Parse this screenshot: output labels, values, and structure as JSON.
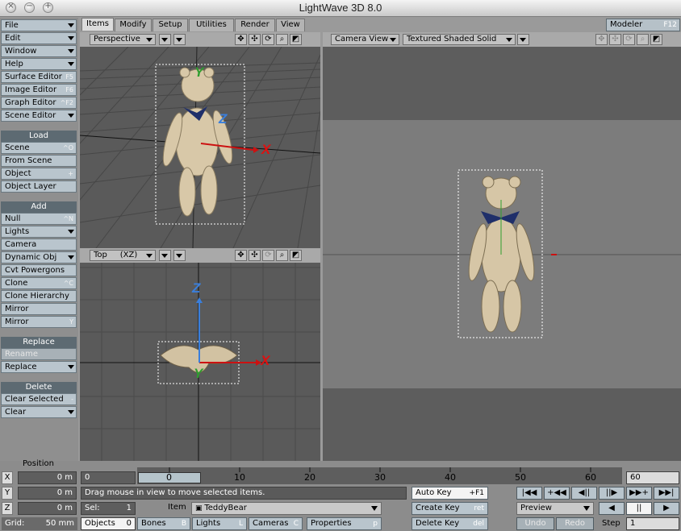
{
  "window": {
    "title": "LightWave 3D 8.0",
    "close_icon": "×",
    "min_icon": "−",
    "zoom_icon": "+"
  },
  "menus": [
    {
      "label": "File",
      "type": "dropdown"
    },
    {
      "label": "Edit",
      "type": "dropdown"
    },
    {
      "label": "Window",
      "type": "dropdown"
    },
    {
      "label": "Help",
      "type": "dropdown"
    },
    {
      "label": "Surface Editor",
      "shortcut": "F5"
    },
    {
      "label": "Image Editor",
      "shortcut": "F6"
    },
    {
      "label": "Graph Editor",
      "shortcut": "^F2"
    },
    {
      "label": "Scene Editor",
      "type": "dropdown"
    }
  ],
  "load": {
    "header": "Load",
    "items": [
      {
        "label": "Scene",
        "shortcut": "^O"
      },
      {
        "label": "From Scene",
        "shortcut": ""
      },
      {
        "label": "Object",
        "shortcut": "+"
      },
      {
        "label": "Object Layer",
        "shortcut": ""
      }
    ]
  },
  "add": {
    "header": "Add",
    "items": [
      {
        "label": "Null",
        "shortcut": "^N"
      },
      {
        "label": "Lights",
        "dropdown": true
      },
      {
        "label": "Camera",
        "shortcut": ""
      },
      {
        "label": "Dynamic Obj",
        "dropdown": true
      },
      {
        "label": "Cvt Powergons",
        "shortcut": ""
      },
      {
        "label": "Clone",
        "shortcut": "^C"
      },
      {
        "label": "Clone Hierarchy",
        "shortcut": ""
      },
      {
        "label": "Mirror",
        "shortcut": ""
      },
      {
        "label": "Mirror",
        "shortcut": "Y"
      }
    ]
  },
  "replace": {
    "header": "Replace",
    "items": [
      {
        "label": "Rename",
        "disabled": true
      },
      {
        "label": "Replace",
        "dropdown": true
      }
    ]
  },
  "delete": {
    "header": "Delete",
    "items": [
      {
        "label": "Clear Selected",
        "shortcut": "-"
      },
      {
        "label": "Clear",
        "dropdown": true
      }
    ]
  },
  "tabs": [
    "Items",
    "Modify",
    "Setup",
    "Utilities",
    "Render",
    "View"
  ],
  "active_tab": "Items",
  "modeler": {
    "label": "Modeler",
    "shortcut": "F12"
  },
  "viewports": {
    "perspective": {
      "view": "Perspective",
      "axes": {
        "x": "X",
        "y": "Y",
        "z": "Z"
      }
    },
    "top": {
      "view": "Top",
      "plane": "(XZ)",
      "axes": {
        "x": "X",
        "y": "Y",
        "z": "Z"
      }
    },
    "camera": {
      "view": "Camera View",
      "shading": "Textured Shaded Solid"
    }
  },
  "position": {
    "label": "Position",
    "x_label": "X",
    "y_label": "Y",
    "z_label": "Z",
    "x": "0 m",
    "y": "0 m",
    "z": "0 m",
    "grid_label": "Grid:",
    "grid": "50 mm"
  },
  "timeline": {
    "start": "0",
    "end": "60",
    "current": "0",
    "ticks": [
      "0",
      "10",
      "20",
      "30",
      "40",
      "50",
      "60"
    ]
  },
  "status": "Drag mouse in view to move selected items.",
  "sel": {
    "label": "Sel:",
    "value": "1"
  },
  "item": {
    "label": "Item",
    "value": "TeddyBear"
  },
  "item_types": [
    {
      "label": "Objects",
      "count": "0"
    },
    {
      "label": "Bones",
      "count": "B"
    },
    {
      "label": "Lights",
      "count": "L"
    },
    {
      "label": "Cameras",
      "count": "C"
    }
  ],
  "properties": {
    "label": "Properties",
    "shortcut": "p"
  },
  "keys": {
    "auto": {
      "label": "Auto Key",
      "shortcut": "+F1"
    },
    "create": {
      "label": "Create Key",
      "shortcut": "ret"
    },
    "delete": {
      "label": "Delete Key",
      "shortcut": "del"
    }
  },
  "transport": {
    "row1": [
      "|◀◀",
      "+◀◀",
      "◀||",
      "||▶",
      "▶▶+",
      "▶▶|"
    ],
    "preview": "Preview",
    "row2": [
      "◀",
      "||",
      "▶"
    ]
  },
  "undo": "Undo",
  "redo": "Redo",
  "step": {
    "label": "Step",
    "value": "1"
  }
}
